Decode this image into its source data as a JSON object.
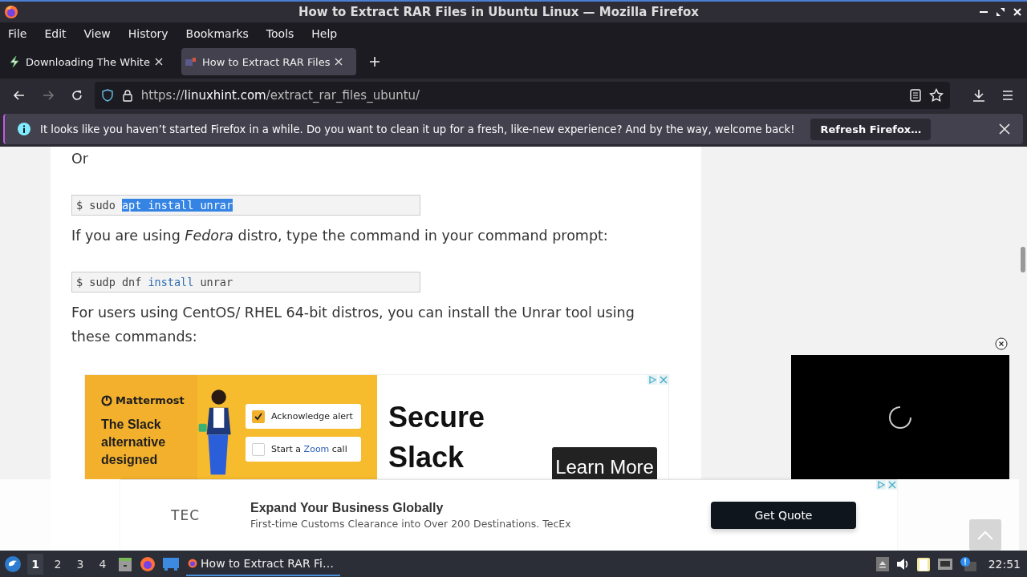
{
  "window": {
    "title": "How to Extract RAR Files in Ubuntu Linux — Mozilla Firefox"
  },
  "menu": [
    {
      "label": "File"
    },
    {
      "label": "Edit"
    },
    {
      "label": "View"
    },
    {
      "label": "History"
    },
    {
      "label": "Bookmarks"
    },
    {
      "label": "Tools"
    },
    {
      "label": "Help"
    }
  ],
  "tabs": [
    {
      "title": "Downloading The White",
      "kind": "bolt",
      "selected": false
    },
    {
      "title": "How to Extract RAR Files",
      "kind": "site",
      "selected": true
    }
  ],
  "address": {
    "scheme": "https://",
    "host": "linuxhint.com",
    "path": "/extract_rar_files_ubuntu/"
  },
  "notification": {
    "text": "It looks like you haven’t started Firefox in a while. Do you want to clean it up for a fresh, like-new experience? And by the way, welcome back!",
    "button": "Refresh Firefox…"
  },
  "article": [
    {
      "kind": "paragraph",
      "text": "Or"
    },
    {
      "kind": "code",
      "segments": [
        {
          "text": "$ sudo ",
          "kind": "plain"
        },
        {
          "text": "apt install unrar",
          "kind": "selected"
        }
      ]
    },
    {
      "kind": "paragraph",
      "text": "If you are using *Fedora* distro, type the command in your command prompt:"
    },
    {
      "kind": "code",
      "segments": [
        {
          "text": "$ sudp dnf ",
          "kind": "plain"
        },
        {
          "text": "install",
          "kind": "keyword"
        },
        {
          "text": " unrar",
          "kind": "plain"
        }
      ]
    },
    {
      "kind": "paragraph",
      "text": "For users using CentOS/ RHEL 64-bit distros, you can install the Unrar tool using these commands:"
    }
  ],
  "ad": {
    "brand": "Mattermost",
    "headline": [
      "The Slack",
      "alternative",
      "designed"
    ],
    "checklist": [
      {
        "parts": [
          {
            "text": "Acknowledge alert",
            "kind": "plain"
          }
        ],
        "checked": true
      },
      {
        "parts": [
          {
            "text": "Start a ",
            "kind": "plain"
          },
          {
            "text": "Zoom",
            "kind": "link"
          },
          {
            "text": " call",
            "kind": "plain"
          }
        ],
        "checked": false
      }
    ],
    "big_text": [
      "Secure",
      "Slack"
    ],
    "button": "Learn More"
  },
  "sticky_ad": {
    "logo": "TEC",
    "title": "Expand Your Business Globally",
    "subtitle": "First-time Customs Clearance into Over 200 Destinations. TecEx",
    "button": "Get Quote"
  },
  "taskbar": {
    "workspaces": [
      {
        "label": "1",
        "selected": true
      },
      {
        "label": "2",
        "selected": false
      },
      {
        "label": "3",
        "selected": false
      },
      {
        "label": "4",
        "selected": false
      }
    ],
    "task": "How to Extract RAR Fi…",
    "clock": "22:51"
  }
}
